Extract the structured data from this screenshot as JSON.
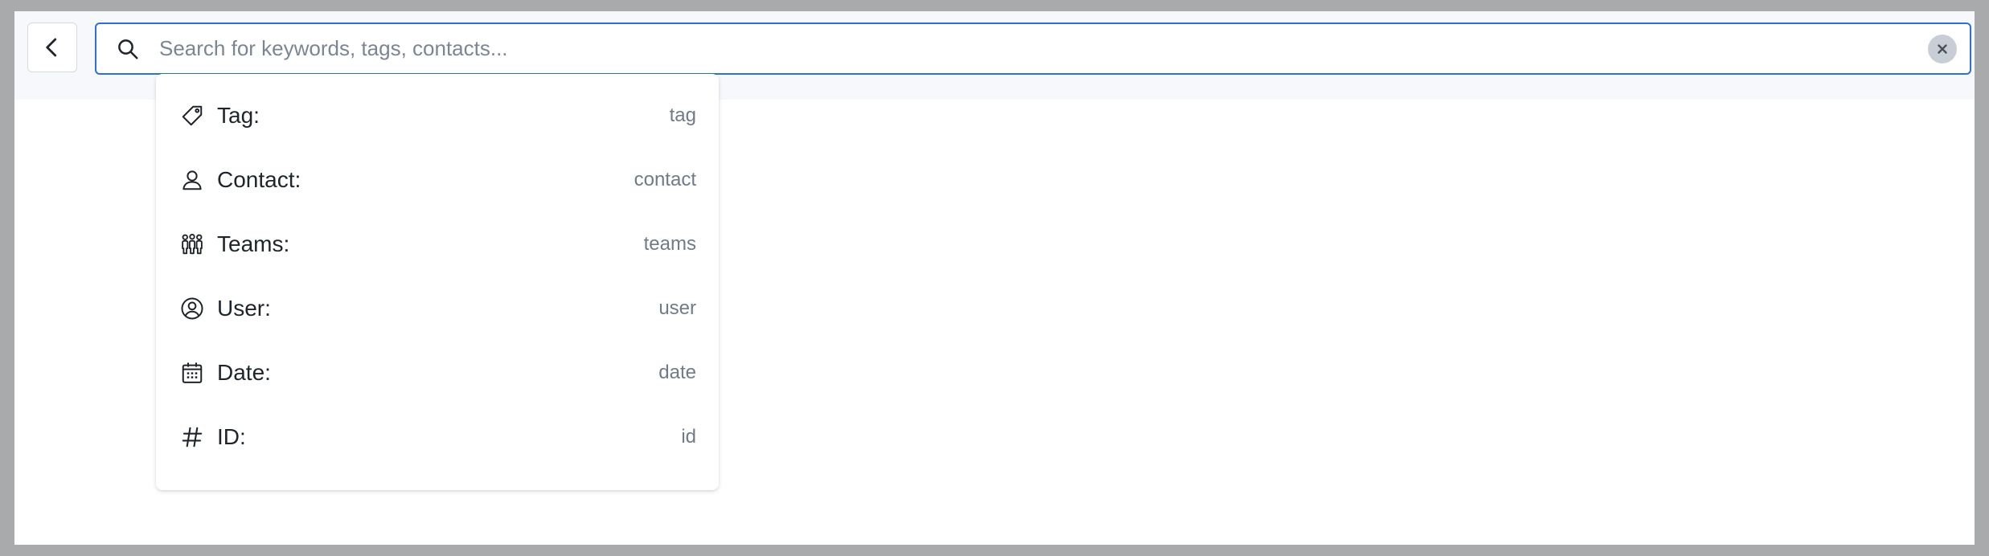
{
  "header": {
    "back_icon": "chevron-left-icon"
  },
  "search": {
    "placeholder": "Search for keywords, tags, contacts...",
    "value": "",
    "search_icon": "search-icon",
    "clear_icon": "close-icon"
  },
  "dropdown": {
    "items": [
      {
        "icon": "tag-icon",
        "label": "Tag:",
        "key": "tag"
      },
      {
        "icon": "contact-icon",
        "label": "Contact:",
        "key": "contact"
      },
      {
        "icon": "teams-icon",
        "label": "Teams:",
        "key": "teams"
      },
      {
        "icon": "user-icon",
        "label": "User:",
        "key": "user"
      },
      {
        "icon": "calendar-icon",
        "label": "Date:",
        "key": "date"
      },
      {
        "icon": "hash-icon",
        "label": "ID:",
        "key": "id"
      }
    ]
  },
  "colors": {
    "accent": "#2f6fd6",
    "outer_background": "#a9aaac",
    "topbar_background": "#f6f8fc",
    "secondary_text": "#717a88"
  }
}
